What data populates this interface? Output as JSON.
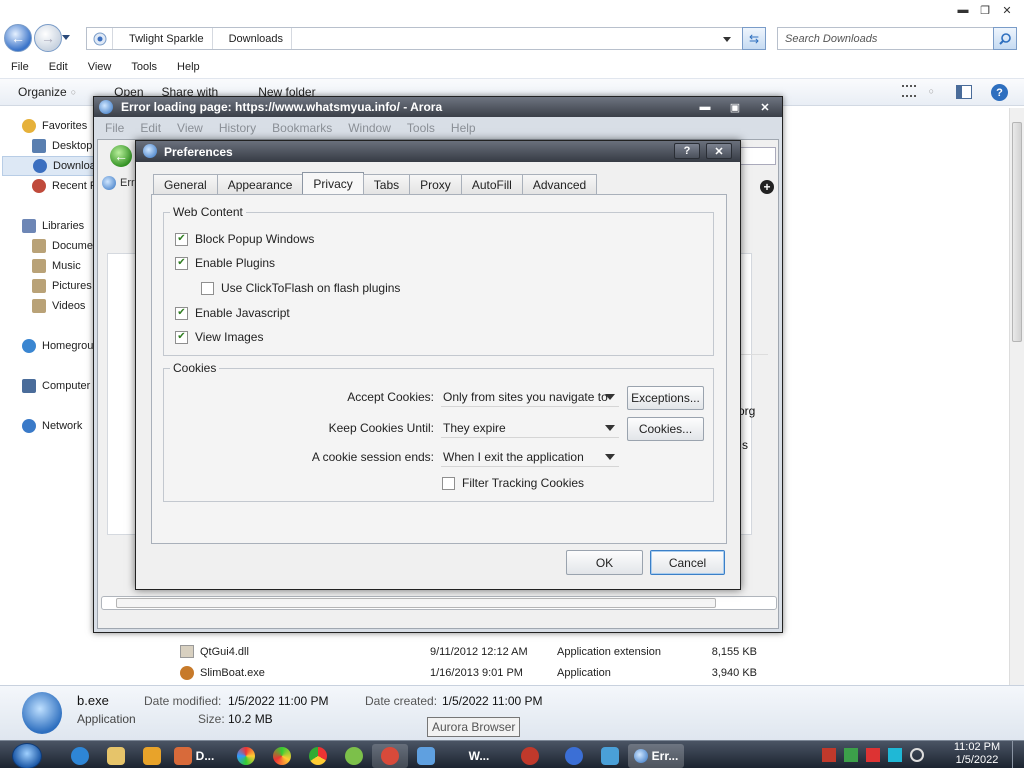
{
  "explorer": {
    "breadcrumb": [
      "Twlight Sparkle",
      "Downloads"
    ],
    "search_placeholder": "Search Downloads",
    "menu": [
      "File",
      "Edit",
      "View",
      "Tools",
      "Help"
    ],
    "commands": [
      "Organize",
      "Open",
      "Share with",
      "New folder"
    ],
    "nav": [
      {
        "label": "Favorites",
        "icon": "star-icon",
        "color": "#e6b13a"
      },
      {
        "label": "Desktop",
        "icon": "desktop-icon",
        "color": "#5a7fb0"
      },
      {
        "label": "Downloads",
        "icon": "downloads-icon",
        "color": "#3b6fc0"
      },
      {
        "label": "Recent Places",
        "icon": "recent-places-icon",
        "color": "#c04a3b"
      },
      {
        "label": "Libraries",
        "icon": "library-icon",
        "color": "#6d86b5"
      },
      {
        "label": "Documents",
        "icon": "documents-icon",
        "color": "#b9a277"
      },
      {
        "label": "Music",
        "icon": "music-icon",
        "color": "#b9a277"
      },
      {
        "label": "Pictures",
        "icon": "pictures-icon",
        "color": "#b9a277"
      },
      {
        "label": "Videos",
        "icon": "videos-icon",
        "color": "#b9a277"
      },
      {
        "label": "Homegroup",
        "icon": "homegroup-icon",
        "color": "#3a86d1"
      },
      {
        "label": "Computer",
        "icon": "computer-icon",
        "color": "#4a6c9a"
      },
      {
        "label": "Network",
        "icon": "network-icon",
        "color": "#3a7ac8"
      }
    ],
    "files": [
      {
        "name": "QtGui4.dll",
        "date": "9/11/2012 12:12 AM",
        "type": "Application extension",
        "size": "8,155 KB"
      },
      {
        "name": "SlimBoat.exe",
        "date": "1/16/2013 9:01 PM",
        "type": "Application",
        "size": "3,940 KB"
      }
    ],
    "details": {
      "filename": "b.exe",
      "filetype": "Application",
      "modified_label": "Date modified:",
      "modified_value": "1/5/2022 11:00 PM",
      "created_label": "Date created:",
      "created_value": "1/5/2022 11:00 PM",
      "size_label": "Size:",
      "size_value": "10.2 MB"
    }
  },
  "arora": {
    "title": "Error loading page: https://www.whatsmyua.info/ - Arora",
    "menu": [
      "File",
      "Edit",
      "View",
      "History",
      "Bookmarks",
      "Window",
      "Tools",
      "Help"
    ],
    "tab_partial": "Err",
    "bg_text_1": "org",
    "bg_text_2": "s"
  },
  "preferences": {
    "title": "Preferences",
    "help_glyph": "?",
    "tabs": [
      "General",
      "Appearance",
      "Privacy",
      "Tabs",
      "Proxy",
      "AutoFill",
      "Advanced"
    ],
    "active_tab": "Privacy",
    "web_content": {
      "title": "Web Content",
      "block_popups": {
        "label": "Block Popup Windows",
        "checked": true
      },
      "enable_plugins": {
        "label": "Enable Plugins",
        "checked": true
      },
      "clicktoflash": {
        "label": "Use ClickToFlash on flash plugins",
        "checked": false
      },
      "enable_javascript": {
        "label": "Enable Javascript",
        "checked": true
      },
      "view_images": {
        "label": "View Images",
        "checked": true
      }
    },
    "cookies": {
      "title": "Cookies",
      "accept_label": "Accept Cookies:",
      "accept_value": "Only from sites you navigate to",
      "exceptions_button": "Exceptions...",
      "keep_label": "Keep Cookies Until:",
      "keep_value": "They expire",
      "cookies_button": "Cookies...",
      "session_label": "A cookie session ends:",
      "session_value": "When I exit the application",
      "filter_tracking": {
        "label": "Filter Tracking Cookies",
        "checked": false
      }
    },
    "ok_button": "OK",
    "cancel_button": "Cancel"
  },
  "taskbar": {
    "tooltip": "Aurora Browser",
    "time": "11:02 PM",
    "date": "1/5/2022",
    "items": [
      {
        "label": "D...",
        "icon": "documents-app-icon"
      },
      {
        "label": "W...",
        "icon": "word-app-icon"
      },
      {
        "label": "Err...",
        "icon": "arora-app-icon"
      }
    ]
  }
}
